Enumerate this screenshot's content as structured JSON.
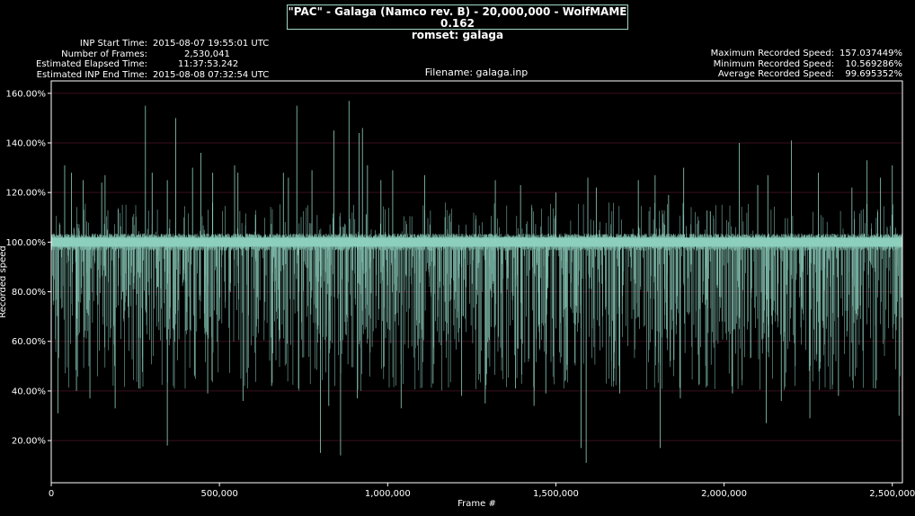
{
  "header": {
    "title_line1": "\"PAC\" - Galaga (Namco rev. B) - 20,000,000 - WolfMAME 0.162",
    "title_line2": "romset: galaga"
  },
  "left_info": [
    {
      "label": "INP Start Time:",
      "value": "2015-08-07 19:55:01 UTC"
    },
    {
      "label": "Number of Frames:",
      "value": "2,530,041"
    },
    {
      "label": "Estimated Elapsed Time:",
      "value": "11:37:53.242"
    },
    {
      "label": "Estimated INP End Time:",
      "value": "2015-08-08 07:32:54 UTC"
    }
  ],
  "right_info": [
    {
      "label": "Maximum Recorded Speed:",
      "value": "157.037449%"
    },
    {
      "label": "Minimum Recorded Speed:",
      "value": "10.569286%"
    },
    {
      "label": "Average Recorded Speed:",
      "value": "99.695352%"
    }
  ],
  "filename": "Filename: galaga.inp",
  "colors": {
    "line": "#8ed1bf",
    "grid": "#3a0f1c",
    "background": "#000000",
    "axis": "#ffffff"
  },
  "chart_data": {
    "type": "line",
    "xlabel": "Frame #",
    "ylabel": "Recorded speed",
    "xlim": [
      0,
      2530041
    ],
    "ylim": [
      3,
      165
    ],
    "x_ticks": [
      0,
      500000,
      1000000,
      1500000,
      2000000,
      2500000
    ],
    "x_tick_labels": [
      "0",
      "500,000",
      "1,000,000",
      "1,500,000",
      "2,000,000",
      "2,500,000"
    ],
    "y_ticks": [
      20,
      40,
      60,
      80,
      100,
      120,
      140,
      160
    ],
    "y_tick_labels": [
      "20.00%",
      "40.00%",
      "60.00%",
      "80.00%",
      "100.00%",
      "120.00%",
      "140.00%",
      "160.00%"
    ],
    "grid": "horizontal",
    "baseline_value": 100,
    "max_value": 157.037449,
    "min_value": 10.569286,
    "average_value": 99.695352,
    "spikes_high": [
      [
        40000,
        131
      ],
      [
        60000,
        128
      ],
      [
        95000,
        125
      ],
      [
        150000,
        124
      ],
      [
        160000,
        127
      ],
      [
        280000,
        155
      ],
      [
        300000,
        128
      ],
      [
        345000,
        125
      ],
      [
        370000,
        150
      ],
      [
        420000,
        130
      ],
      [
        445000,
        136
      ],
      [
        480000,
        128
      ],
      [
        545000,
        131
      ],
      [
        555000,
        128
      ],
      [
        690000,
        128
      ],
      [
        705000,
        126
      ],
      [
        730000,
        155
      ],
      [
        775000,
        129
      ],
      [
        840000,
        145
      ],
      [
        885000,
        157
      ],
      [
        915000,
        144
      ],
      [
        925000,
        146
      ],
      [
        940000,
        131
      ],
      [
        980000,
        125
      ],
      [
        1015000,
        129
      ],
      [
        1110000,
        127
      ],
      [
        1320000,
        125
      ],
      [
        1395000,
        123
      ],
      [
        1500000,
        120
      ],
      [
        1595000,
        126
      ],
      [
        1620000,
        122
      ],
      [
        1745000,
        125
      ],
      [
        1795000,
        127
      ],
      [
        1835000,
        119
      ],
      [
        1880000,
        130
      ],
      [
        2045000,
        140
      ],
      [
        2100000,
        123
      ],
      [
        2130000,
        127
      ],
      [
        2200000,
        141
      ],
      [
        2280000,
        128
      ],
      [
        2380000,
        122
      ],
      [
        2425000,
        133
      ],
      [
        2465000,
        126
      ],
      [
        2500000,
        131
      ]
    ],
    "spikes_low": [
      [
        20000,
        31
      ],
      [
        75000,
        40
      ],
      [
        115000,
        37
      ],
      [
        190000,
        33
      ],
      [
        260000,
        41
      ],
      [
        345000,
        18
      ],
      [
        465000,
        39
      ],
      [
        570000,
        36
      ],
      [
        655000,
        42
      ],
      [
        735000,
        41
      ],
      [
        800000,
        15
      ],
      [
        825000,
        34
      ],
      [
        860000,
        14
      ],
      [
        910000,
        37
      ],
      [
        1040000,
        33
      ],
      [
        1135000,
        43
      ],
      [
        1220000,
        38
      ],
      [
        1290000,
        35
      ],
      [
        1380000,
        41
      ],
      [
        1435000,
        34
      ],
      [
        1470000,
        39
      ],
      [
        1575000,
        17
      ],
      [
        1590000,
        11
      ],
      [
        1690000,
        39
      ],
      [
        1810000,
        17
      ],
      [
        1870000,
        37
      ],
      [
        1950000,
        42
      ],
      [
        2025000,
        39
      ],
      [
        2125000,
        27
      ],
      [
        2170000,
        36
      ],
      [
        2255000,
        29
      ],
      [
        2340000,
        38
      ],
      [
        2450000,
        41
      ],
      [
        2520000,
        30
      ]
    ]
  }
}
